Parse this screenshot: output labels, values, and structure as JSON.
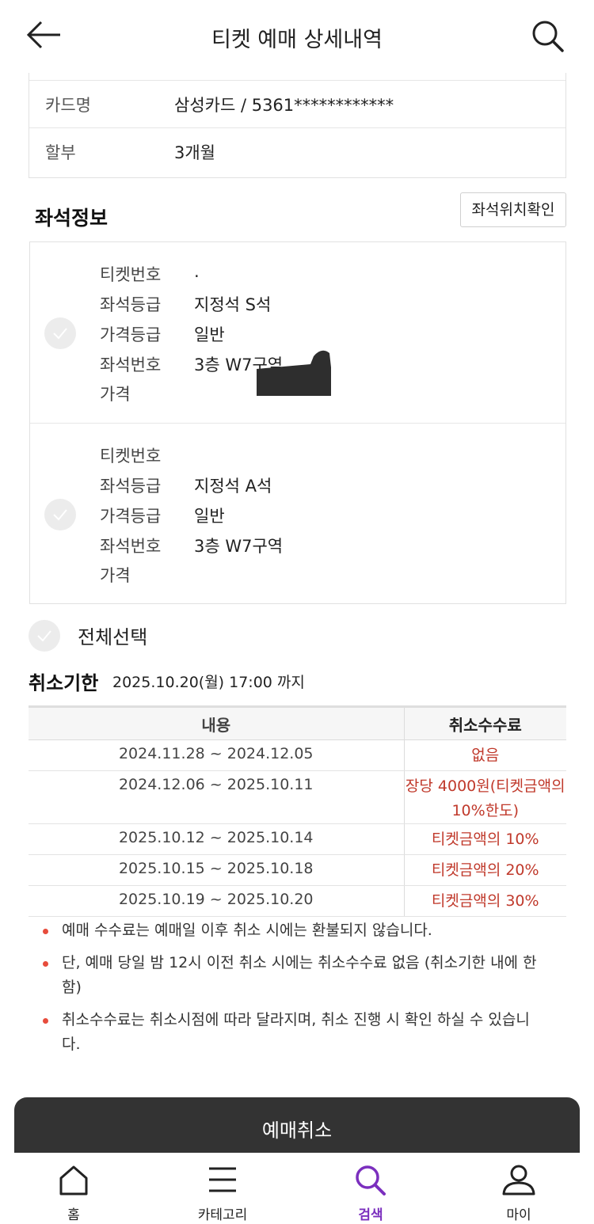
{
  "header": {
    "title": "티켓 예매 상세내역"
  },
  "payment": {
    "rows": [
      {
        "key": "카드명",
        "value": "삼성카드 / 5361************"
      },
      {
        "key": "할부",
        "value": "3개월"
      }
    ]
  },
  "seat_info": {
    "heading": "좌석정보",
    "location_button": "좌석위치확인",
    "tickets": [
      {
        "rows": [
          {
            "key": "티켓번호",
            "value": "."
          },
          {
            "key": "좌석등급",
            "value": "지정석 S석"
          },
          {
            "key": "가격등급",
            "value": "일반"
          },
          {
            "key": "좌석번호",
            "value": "3층 W7구역"
          },
          {
            "key": "가격",
            "value": ""
          }
        ]
      },
      {
        "rows": [
          {
            "key": "티켓번호",
            "value": ""
          },
          {
            "key": "좌석등급",
            "value": "지정석 A석"
          },
          {
            "key": "가격등급",
            "value": "일반"
          },
          {
            "key": "좌석번호",
            "value": "3층 W7구역"
          },
          {
            "key": "가격",
            "value": ""
          }
        ]
      }
    ]
  },
  "select_all": "전체선택",
  "deadline": {
    "label": "취소기한",
    "value": "2025.10.20(월) 17:00 까지"
  },
  "fee_table": {
    "headers": [
      "내용",
      "취소수수료"
    ],
    "rows": [
      {
        "period": "2024.11.28 ~ 2024.12.05",
        "fee": "없음"
      },
      {
        "period": "2024.12.06 ~ 2025.10.11",
        "fee": "장당 4000원(티켓금액의 10%한도)"
      },
      {
        "period": "2025.10.12 ~ 2025.10.14",
        "fee": "티켓금액의 10%"
      },
      {
        "period": "2025.10.15 ~ 2025.10.18",
        "fee": "티켓금액의 20%"
      },
      {
        "period": "2025.10.19 ~ 2025.10.20",
        "fee": "티켓금액의 30%"
      }
    ]
  },
  "notes": [
    "예매 수수료는 예매일 이후 취소 시에는 환불되지 않습니다.",
    "단, 예매 당일 밤 12시 이전 취소 시에는 취소수수료 없음 (취소기한 내에 한함)",
    "취소수수료는 취소시점에 따라 달라지며, 취소 진행 시 확인 하실 수 있습니다."
  ],
  "cancel_button": "예매취소",
  "bottom_nav": {
    "items": [
      {
        "label": "홈",
        "icon": "home-icon"
      },
      {
        "label": "카테고리",
        "icon": "menu-icon"
      },
      {
        "label": "검색",
        "icon": "search-icon",
        "active": true
      },
      {
        "label": "마이",
        "icon": "user-icon"
      }
    ]
  },
  "colors": {
    "accent": "#7b2fbe",
    "fee_red": "#c0392b",
    "button_dark": "#333333",
    "bullet_red": "#e74c3c"
  }
}
